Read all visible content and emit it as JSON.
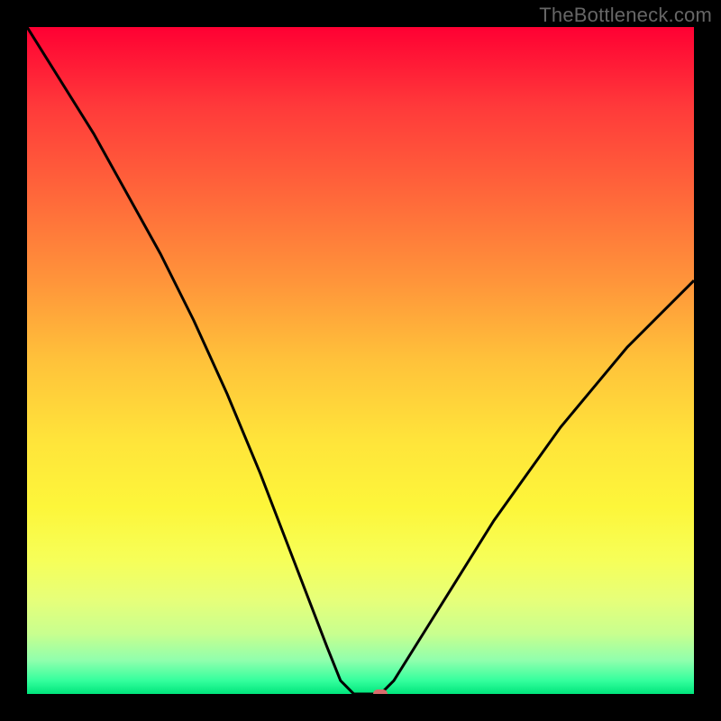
{
  "watermark": "TheBottleneck.com",
  "colors": {
    "page_bg": "#000000",
    "curve": "#000000",
    "marker": "#d86c6c",
    "gradient_top": "#ff0033",
    "gradient_bottom": "#00e57c"
  },
  "chart_data": {
    "type": "line",
    "title": "",
    "xlabel": "",
    "ylabel": "",
    "xlim": [
      0,
      100
    ],
    "ylim": [
      0,
      100
    ],
    "x": [
      0,
      5,
      10,
      15,
      20,
      25,
      30,
      35,
      40,
      45,
      47,
      49,
      50,
      51,
      53,
      55,
      60,
      65,
      70,
      75,
      80,
      85,
      90,
      95,
      100
    ],
    "values": [
      100,
      92,
      84,
      75,
      66,
      56,
      45,
      33,
      20,
      7,
      2,
      0,
      0,
      0,
      0,
      2,
      10,
      18,
      26,
      33,
      40,
      46,
      52,
      57,
      62
    ],
    "marker": {
      "x": 53,
      "y": 0
    },
    "grid": false,
    "legend": false
  }
}
